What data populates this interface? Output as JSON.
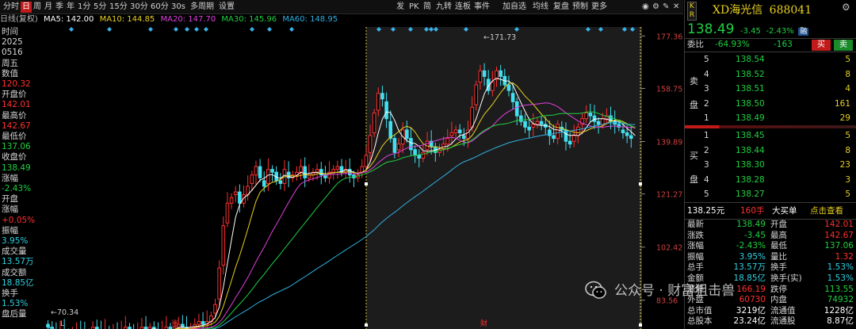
{
  "toolbar": {
    "periods": [
      "分时",
      "日",
      "周",
      "月",
      "季",
      "年",
      "1分",
      "5分",
      "15分",
      "30分",
      "60分",
      "30s",
      "多周期",
      "设置"
    ],
    "active_period": "日",
    "right_items": [
      "发",
      "PK",
      "简",
      "九转",
      "连板",
      "事件",
      "加自选",
      "均线",
      "复盘",
      "预制",
      "更多"
    ]
  },
  "ma_legend": {
    "label": "日线(复权)",
    "ma5": "MA5: 142.00",
    "ma10": "MA10: 144.85",
    "ma20": "MA20: 147.70",
    "ma30": "MA30: 145.96",
    "ma60": "MA60: 148.95",
    "colors": {
      "ma5": "#ffffff",
      "ma10": "#e8d020",
      "ma20": "#e040e0",
      "ma30": "#20d040",
      "ma60": "#30b0e0"
    }
  },
  "left_info": {
    "time_label": "时间",
    "year": "2025",
    "date": "0516",
    "weekday": "周五",
    "value_label": "数值",
    "value": "120.32",
    "open_label": "开盘价",
    "open": "142.01",
    "high_label": "最高价",
    "high": "142.67",
    "low_label": "最低价",
    "low": "137.06",
    "close_label": "收盘价",
    "close": "138.49",
    "chg_label": "涨幅",
    "chg": "-2.43%",
    "openchg_label1": "开盘",
    "openchg_label2": "涨幅",
    "openchg": "+0.05%",
    "amp_label": "振幅",
    "amp": "3.95%",
    "vol_label": "成交量",
    "vol": "13.57万",
    "amt_label": "成交额",
    "amt": "18.85亿",
    "turn_label": "换手",
    "turn": "1.53%",
    "after_label": "盘后量"
  },
  "chart_data": {
    "type": "candlestick",
    "y_ticks": [
      "177.36",
      "158.75",
      "139.89",
      "121.27",
      "102.42",
      "83.56"
    ],
    "ylim": [
      77,
      180
    ],
    "annotations": {
      "high": "171.73",
      "low": "70.34"
    },
    "markers_bottom": [
      "L",
      "涨",
      "财"
    ],
    "ma_colors": [
      "#ffffff",
      "#e8d020",
      "#e040e0",
      "#20d040",
      "#30b0e0"
    ],
    "closes": [
      74,
      73,
      72,
      73,
      72,
      71,
      72,
      73,
      72,
      71,
      72,
      74,
      73,
      72,
      73,
      72,
      73,
      72,
      73,
      74,
      73,
      72,
      73,
      74,
      73,
      74,
      73,
      72,
      73,
      74,
      73,
      74,
      75,
      74,
      73,
      74,
      75,
      76,
      75,
      76,
      78,
      82,
      95,
      110,
      118,
      120,
      122,
      118,
      121,
      124,
      128,
      131,
      127,
      124,
      130,
      129,
      126,
      125,
      130,
      127,
      128,
      129,
      131,
      127,
      128,
      129,
      130,
      128,
      127,
      129,
      130,
      131,
      129,
      130,
      128,
      127,
      128,
      131,
      135,
      142,
      150,
      157,
      155,
      148,
      141,
      136,
      139,
      144,
      141,
      137,
      135,
      134,
      136,
      140,
      138,
      136,
      137,
      139,
      141,
      143,
      144,
      143,
      141,
      144,
      152,
      160,
      165,
      163,
      158,
      161,
      165,
      163,
      160,
      158,
      154,
      149,
      147,
      145,
      144,
      146,
      147,
      146,
      145,
      142,
      141,
      146,
      144,
      140,
      139,
      142,
      145,
      148,
      150,
      149,
      147,
      146,
      148,
      149,
      147,
      146,
      145,
      143,
      142,
      141,
      139
    ],
    "opens": [
      75,
      74,
      73,
      72,
      73,
      72,
      71,
      72,
      73,
      72,
      71,
      72,
      74,
      73,
      72,
      73,
      72,
      73,
      72,
      73,
      74,
      73,
      72,
      73,
      74,
      73,
      74,
      73,
      72,
      73,
      74,
      73,
      74,
      75,
      74,
      73,
      74,
      75,
      76,
      75,
      76,
      79,
      84,
      96,
      111,
      118,
      121,
      122,
      118,
      121,
      125,
      128,
      131,
      126,
      125,
      130,
      129,
      126,
      125,
      129,
      127,
      128,
      129,
      131,
      127,
      128,
      129,
      130,
      128,
      127,
      129,
      130,
      131,
      129,
      130,
      128,
      127,
      129,
      131,
      136,
      143,
      151,
      157,
      154,
      147,
      141,
      137,
      139,
      144,
      141,
      137,
      135,
      134,
      137,
      140,
      138,
      136,
      137,
      139,
      142,
      143,
      144,
      142,
      141,
      145,
      153,
      161,
      165,
      162,
      158,
      162,
      165,
      163,
      160,
      157,
      154,
      149,
      147,
      145,
      145,
      146,
      147,
      146,
      144,
      142,
      141,
      145,
      144,
      140,
      140,
      142,
      146,
      148,
      150,
      149,
      147,
      146,
      148,
      149,
      147,
      146,
      144,
      143,
      142
    ]
  },
  "quote": {
    "badge_top": "K",
    "badge_bottom": "R",
    "name": "XD海光信",
    "code": "688041",
    "price": "138.49",
    "change": "-3.45",
    "change_pct": "-2.43%",
    "tag": "融",
    "weibi_label": "委比",
    "weibi": "-64.93%",
    "weicha": "-163",
    "buy_btn": "买",
    "sell_btn": "卖",
    "sell_label_1": "卖",
    "sell_label_2": "盘",
    "buy_label_1": "买",
    "buy_label_2": "盘",
    "asks": [
      {
        "lvl": "5",
        "price": "138.54",
        "vol": "5"
      },
      {
        "lvl": "4",
        "price": "138.52",
        "vol": "8"
      },
      {
        "lvl": "3",
        "price": "138.51",
        "vol": "4"
      },
      {
        "lvl": "2",
        "price": "138.50",
        "vol": "161"
      },
      {
        "lvl": "1",
        "price": "138.49",
        "vol": "29"
      }
    ],
    "bids": [
      {
        "lvl": "1",
        "price": "138.45",
        "vol": "5"
      },
      {
        "lvl": "2",
        "price": "138.44",
        "vol": "8"
      },
      {
        "lvl": "3",
        "price": "138.30",
        "vol": "23"
      },
      {
        "lvl": "4",
        "price": "138.28",
        "vol": "3"
      },
      {
        "lvl": "5",
        "price": "138.27",
        "vol": "5"
      }
    ],
    "bigorder": {
      "price": "138.25元",
      "vol": "160手",
      "type": "大买单",
      "link": "点击查看"
    },
    "stats": [
      [
        "最新",
        "138.49",
        "开盘",
        "142.01"
      ],
      [
        "涨跌",
        "-3.45",
        "最高",
        "142.67"
      ],
      [
        "涨幅",
        "-2.43%",
        "最低",
        "137.06"
      ],
      [
        "振幅",
        "3.95%",
        "量比",
        "1.32"
      ],
      [
        "总手",
        "13.57万",
        "换手",
        "1.53%"
      ],
      [
        "金额",
        "18.85亿",
        "换手(实)",
        "1.53%"
      ],
      [
        "涨停",
        "166.19",
        "跌停",
        "113.55"
      ],
      [
        "外盘",
        "60730",
        "内盘",
        "74932"
      ],
      [
        "总市值",
        "3219亿",
        "流通值",
        "1228亿"
      ],
      [
        "总股本",
        "23.24亿",
        "流通股",
        "8.87亿"
      ]
    ]
  },
  "watermark": "公众号 · 财富狙击兽"
}
